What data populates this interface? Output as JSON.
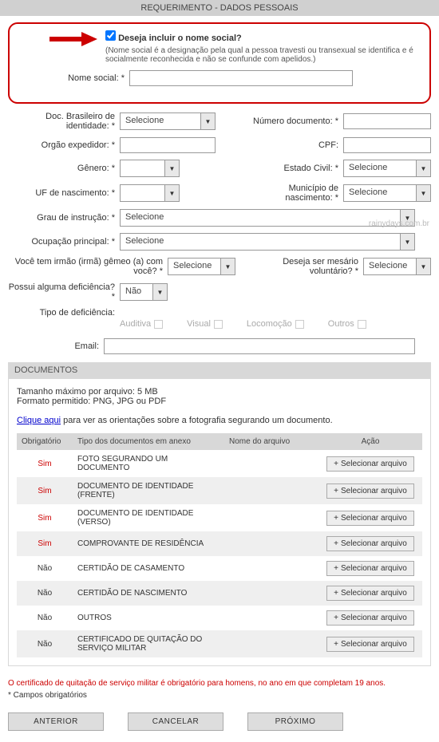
{
  "header": {
    "title": "REQUERIMENTO - DADOS PESSOAIS"
  },
  "highlight": {
    "checkbox_label": "Deseja incluir o nome social?",
    "description": "(Nome social é a designação pela qual a pessoa travesti ou transexual se identifica e é socialmente reconhecida e não se confunde com apelidos.)",
    "nome_social_label": "Nome social: *"
  },
  "fields": {
    "doc_br_label": "Doc. Brasileiro de identidade: *",
    "doc_br_value": "Selecione",
    "num_doc_label": "Número documento: *",
    "orgao_label": "Orgão expedidor: *",
    "cpf_label": "CPF:",
    "genero_label": "Gênero: *",
    "estado_civil_label": "Estado Civil: *",
    "estado_civil_value": "Selecione",
    "uf_nasc_label": "UF de nascimento: *",
    "municipio_label": "Município de nascimento: *",
    "municipio_value": "Selecione",
    "grau_label": "Grau de instrução: *",
    "grau_value": "Selecione",
    "ocupacao_label": "Ocupação principal: *",
    "ocupacao_value": "Selecione",
    "irmao_label": "Você tem irmão (irmã) gêmeo (a) com você? *",
    "irmao_value": "Selecione",
    "mesario_label": "Deseja ser mesário voluntário? *",
    "mesario_value": "Selecione",
    "deficiencia_label": "Possui alguma deficiência? *",
    "deficiencia_value": "Não",
    "tipo_def_label": "Tipo de deficiência:",
    "def_opts": {
      "auditiva": "Auditiva",
      "visual": "Visual",
      "locomocao": "Locomoção",
      "outros": "Outros"
    },
    "email_label": "Email:"
  },
  "documentos": {
    "section_title": "DOCUMENTOS",
    "max_size": "Tamanho máximo por arquivo: 5 MB",
    "format": "Formato permitido: PNG, JPG ou PDF",
    "link_text": "Clique aqui",
    "link_rest": " para ver as orientações sobre a fotografia segurando um documento.",
    "headers": {
      "obrig": "Obrigatório",
      "tipo": "Tipo dos documentos em anexo",
      "nome": "Nome do arquivo",
      "acao": "Ação"
    },
    "btn_label": "Selecionar arquivo",
    "rows": [
      {
        "obrig": "Sim",
        "tipo": "FOTO SEGURANDO UM DOCUMENTO"
      },
      {
        "obrig": "Sim",
        "tipo": "DOCUMENTO DE IDENTIDADE (FRENTE)"
      },
      {
        "obrig": "Sim",
        "tipo": "DOCUMENTO DE IDENTIDADE (VERSO)"
      },
      {
        "obrig": "Sim",
        "tipo": "COMPROVANTE DE RESIDÊNCIA"
      },
      {
        "obrig": "Não",
        "tipo": "CERTIDÃO DE CASAMENTO"
      },
      {
        "obrig": "Não",
        "tipo": "CERTIDÃO DE NASCIMENTO"
      },
      {
        "obrig": "Não",
        "tipo": "OUTROS"
      },
      {
        "obrig": "Não",
        "tipo": "CERTIFICADO DE QUITAÇÃO DO SERVIÇO MILITAR"
      }
    ]
  },
  "footer": {
    "warning": "O certificado de quitação de serviço militar é obrigatório para homens, no ano em que completam 19 anos.",
    "obrig": "* Campos obrigatórios",
    "anterior": "ANTERIOR",
    "cancelar": "CANCELAR",
    "proximo": "PRÓXIMO"
  },
  "watermark": "rainydays.com.br"
}
